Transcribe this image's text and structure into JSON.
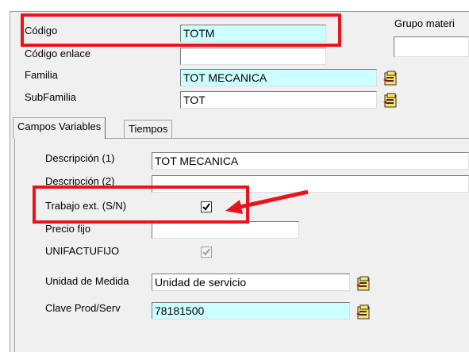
{
  "header": {
    "codigo_label": "Código",
    "codigo_value": "TOTM",
    "codigo_enlace_label": "Código enlace",
    "codigo_enlace_value": "",
    "familia_label": "Familia",
    "familia_value": "TOT MECANICA",
    "subfamilia_label": "SubFamilia",
    "subfamilia_value": "TOT",
    "grupo_label": "Grupo materi",
    "grupo_value": ""
  },
  "tabs": [
    {
      "label": "Campos Variables",
      "active": true
    },
    {
      "label": "Tiempos",
      "active": false
    }
  ],
  "panel": {
    "descripcion1_label": "Descripción (1)",
    "descripcion1_value": "TOT MECANICA",
    "descripcion2_label": "Descripción (2)",
    "descripcion2_value": "",
    "trabajo_label": "Trabajo ext. (S/N)",
    "trabajo_checked": true,
    "precio_label": "Precio fijo",
    "precio_value": "",
    "unifactufijo_label": "UNIFACTUFIJO",
    "unifactufijo_checked": true,
    "unidad_label": "Unidad de Medida",
    "unidad_value": "Unidad de servicio",
    "clave_label": "Clave Prod/Serv",
    "clave_value": "78181500"
  },
  "icons": {
    "lookup": "lookup-folder-icon",
    "check": "checkmark-icon",
    "arrow": "red-arrow-icon"
  },
  "colors": {
    "highlight": "#e8141c",
    "required_field": "#ccffff",
    "window_bg": "#f0f0f0"
  }
}
